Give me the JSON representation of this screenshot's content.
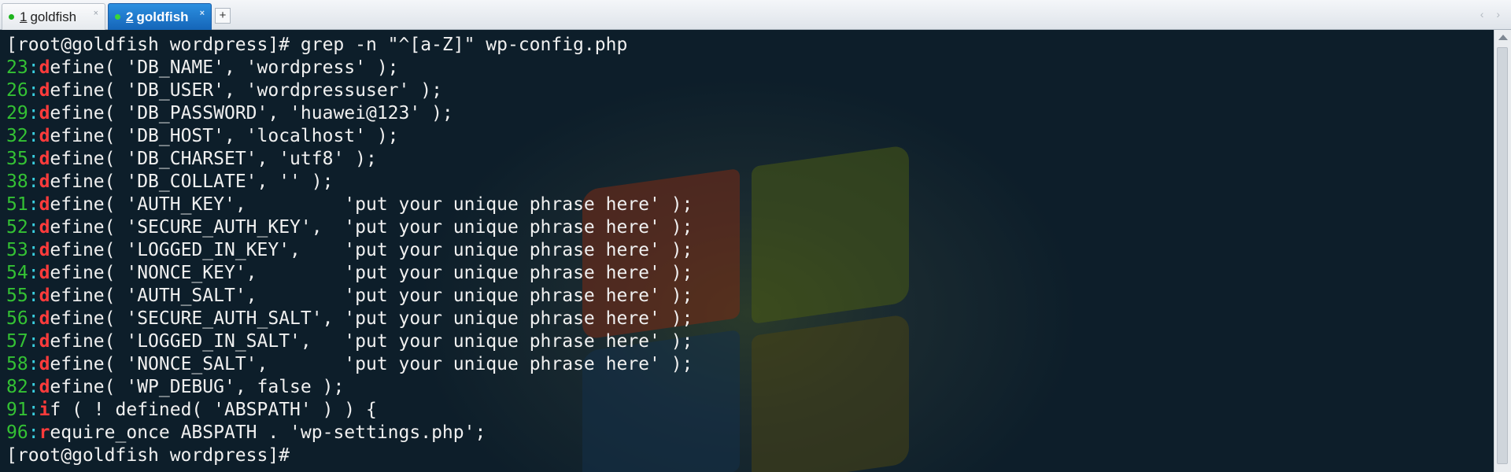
{
  "tabs": [
    {
      "num": "1",
      "label": "goldfish",
      "close": "×"
    },
    {
      "num": "2",
      "label": "goldfish",
      "close": "×"
    }
  ],
  "add_tab": "+",
  "tab_nav": "‹ ›",
  "terminal": {
    "lines": [
      {
        "prompt": "[root@goldfish wordpress]# ",
        "cmd": "grep -n \"^[a-Z]\" wp-config.php"
      },
      {
        "n": "23",
        "first": "d",
        "rest": "efine( 'DB_NAME', 'wordpress' );"
      },
      {
        "n": "26",
        "first": "d",
        "rest": "efine( 'DB_USER', 'wordpressuser' );"
      },
      {
        "n": "29",
        "first": "d",
        "rest": "efine( 'DB_PASSWORD', 'huawei@123' );"
      },
      {
        "n": "32",
        "first": "d",
        "rest": "efine( 'DB_HOST', 'localhost' );"
      },
      {
        "n": "35",
        "first": "d",
        "rest": "efine( 'DB_CHARSET', 'utf8' );"
      },
      {
        "n": "38",
        "first": "d",
        "rest": "efine( 'DB_COLLATE', '' );"
      },
      {
        "n": "51",
        "first": "d",
        "rest": "efine( 'AUTH_KEY',         'put your unique phrase here' );"
      },
      {
        "n": "52",
        "first": "d",
        "rest": "efine( 'SECURE_AUTH_KEY',  'put your unique phrase here' );"
      },
      {
        "n": "53",
        "first": "d",
        "rest": "efine( 'LOGGED_IN_KEY',    'put your unique phrase here' );"
      },
      {
        "n": "54",
        "first": "d",
        "rest": "efine( 'NONCE_KEY',        'put your unique phrase here' );"
      },
      {
        "n": "55",
        "first": "d",
        "rest": "efine( 'AUTH_SALT',        'put your unique phrase here' );"
      },
      {
        "n": "56",
        "first": "d",
        "rest": "efine( 'SECURE_AUTH_SALT', 'put your unique phrase here' );"
      },
      {
        "n": "57",
        "first": "d",
        "rest": "efine( 'LOGGED_IN_SALT',   'put your unique phrase here' );"
      },
      {
        "n": "58",
        "first": "d",
        "rest": "efine( 'NONCE_SALT',       'put your unique phrase here' );"
      },
      {
        "n": "82",
        "first": "d",
        "rest": "efine( 'WP_DEBUG', false );"
      },
      {
        "n": "91",
        "first": "i",
        "rest": "f ( ! defined( 'ABSPATH' ) ) {"
      },
      {
        "n": "96",
        "first": "r",
        "rest": "equire_once ABSPATH . 'wp-settings.php';"
      },
      {
        "prompt": "[root@goldfish wordpress]# ",
        "cmd": ""
      }
    ]
  },
  "colors": {
    "line_number": "#34c234",
    "match": "#ff3b3b",
    "separator": "#3ad0e0",
    "tab_active": "#1565b8"
  }
}
